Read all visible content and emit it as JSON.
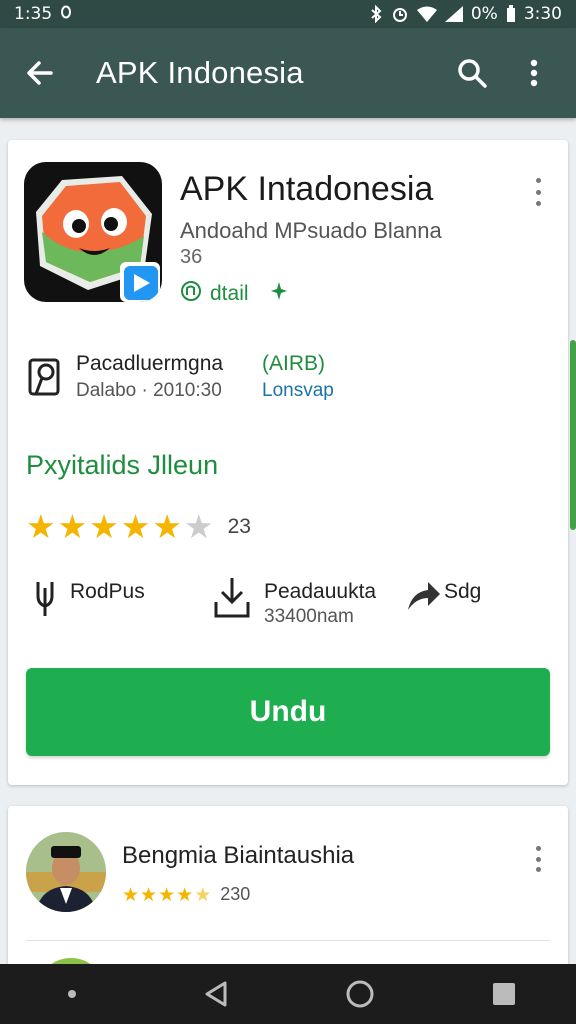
{
  "status_bar": {
    "time": "1:35",
    "left_icon": "notification-icon",
    "battery": "0%",
    "clock_right": "3:30",
    "icons": [
      "bluetooth-icon",
      "alarm-icon",
      "wifi-icon",
      "signal-icon",
      "battery-icon"
    ]
  },
  "app_bar": {
    "title": "APK Indonesia",
    "back_icon": "arrow-back-icon",
    "search_icon": "search-icon",
    "more_icon": "more-vert-icon",
    "color": "#3b5753"
  },
  "app": {
    "name": "APK Intadonesia",
    "developer": "Andoahd MPsuado Blanna",
    "dev_number": "36",
    "detail_label": "dtail",
    "icon_name": "app-mascot-icon"
  },
  "package": {
    "name": "Pacadluermgna",
    "date": "Dalabo · 2010:30",
    "tag": "(AIRB)",
    "sub": "Lonsvap"
  },
  "section_title": "Pxyitalids Jlleun",
  "rating": {
    "stars": 5,
    "max": 6,
    "count": "23"
  },
  "stats": [
    {
      "label": "RodPus",
      "sub": "",
      "icon": "usb-icon"
    },
    {
      "label": "Peadauukta",
      "sub": "33400nam",
      "icon": "download-icon"
    },
    {
      "label": "Sdg",
      "sub": "",
      "icon": "share-arrow-icon"
    }
  ],
  "install_button": {
    "label": "Undu",
    "color": "#1fae4f"
  },
  "review": {
    "name": "Bengmia Biaintaushia",
    "stars": 4,
    "max": 5,
    "count": "230"
  },
  "nav": {
    "icons": [
      "dot-icon",
      "back-triangle-icon",
      "home-circle-icon",
      "recents-square-icon"
    ]
  },
  "accent_green": "#1e8e3e"
}
